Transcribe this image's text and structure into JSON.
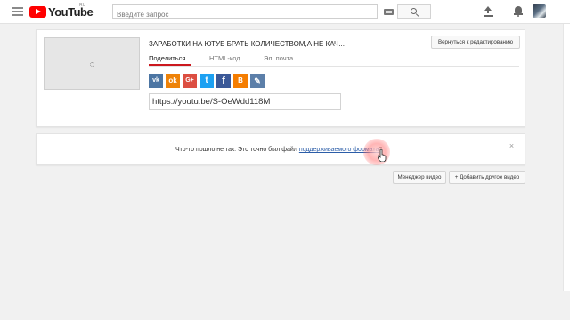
{
  "header": {
    "logo_text": "YouTube",
    "logo_region": "RU",
    "search_placeholder": "Введите запрос",
    "icons": [
      "menu-icon",
      "keyboard-icon",
      "search-icon",
      "upload-icon",
      "bell-icon",
      "avatar"
    ]
  },
  "upload_card": {
    "title": "ЗАРАБОТКИ НА ЮТУБ БРАТЬ КОЛИЧЕСТВОМ,А НЕ КАЧ...",
    "back_button": "Вернуться к редактированию",
    "tabs": [
      {
        "label": "Поделиться",
        "active": true
      },
      {
        "label": "HTML-код",
        "active": false
      },
      {
        "label": "Эл. почта",
        "active": false
      }
    ],
    "social": [
      {
        "name": "vk",
        "glyph": "vk",
        "color": "#4c75a3"
      },
      {
        "name": "odnoklassniki",
        "glyph": "ok",
        "color": "#ee8208"
      },
      {
        "name": "google-plus",
        "glyph": "G+",
        "color": "#dc4e41"
      },
      {
        "name": "twitter",
        "glyph": "t",
        "color": "#1da1f2"
      },
      {
        "name": "facebook",
        "glyph": "f",
        "color": "#3b5998"
      },
      {
        "name": "blogger",
        "glyph": "B",
        "color": "#f57d00"
      },
      {
        "name": "livejournal",
        "glyph": "✎",
        "color": "#5c7fa9"
      }
    ],
    "share_url": "https://youtu.be/S-OeWdd118M"
  },
  "error_card": {
    "text_before": "Что-то пошло не так. Это точно был файл ",
    "link_text": "поддерживаемого формата",
    "text_after": "?",
    "close_glyph": "×"
  },
  "actions": {
    "manager_label": "Менеджер видео",
    "add_label": "+ Добавить другое видео"
  },
  "colors": {
    "brand_red": "#ff0000",
    "tab_accent": "#cc181e",
    "link": "#2b5da8",
    "background": "#f1f1f1"
  }
}
